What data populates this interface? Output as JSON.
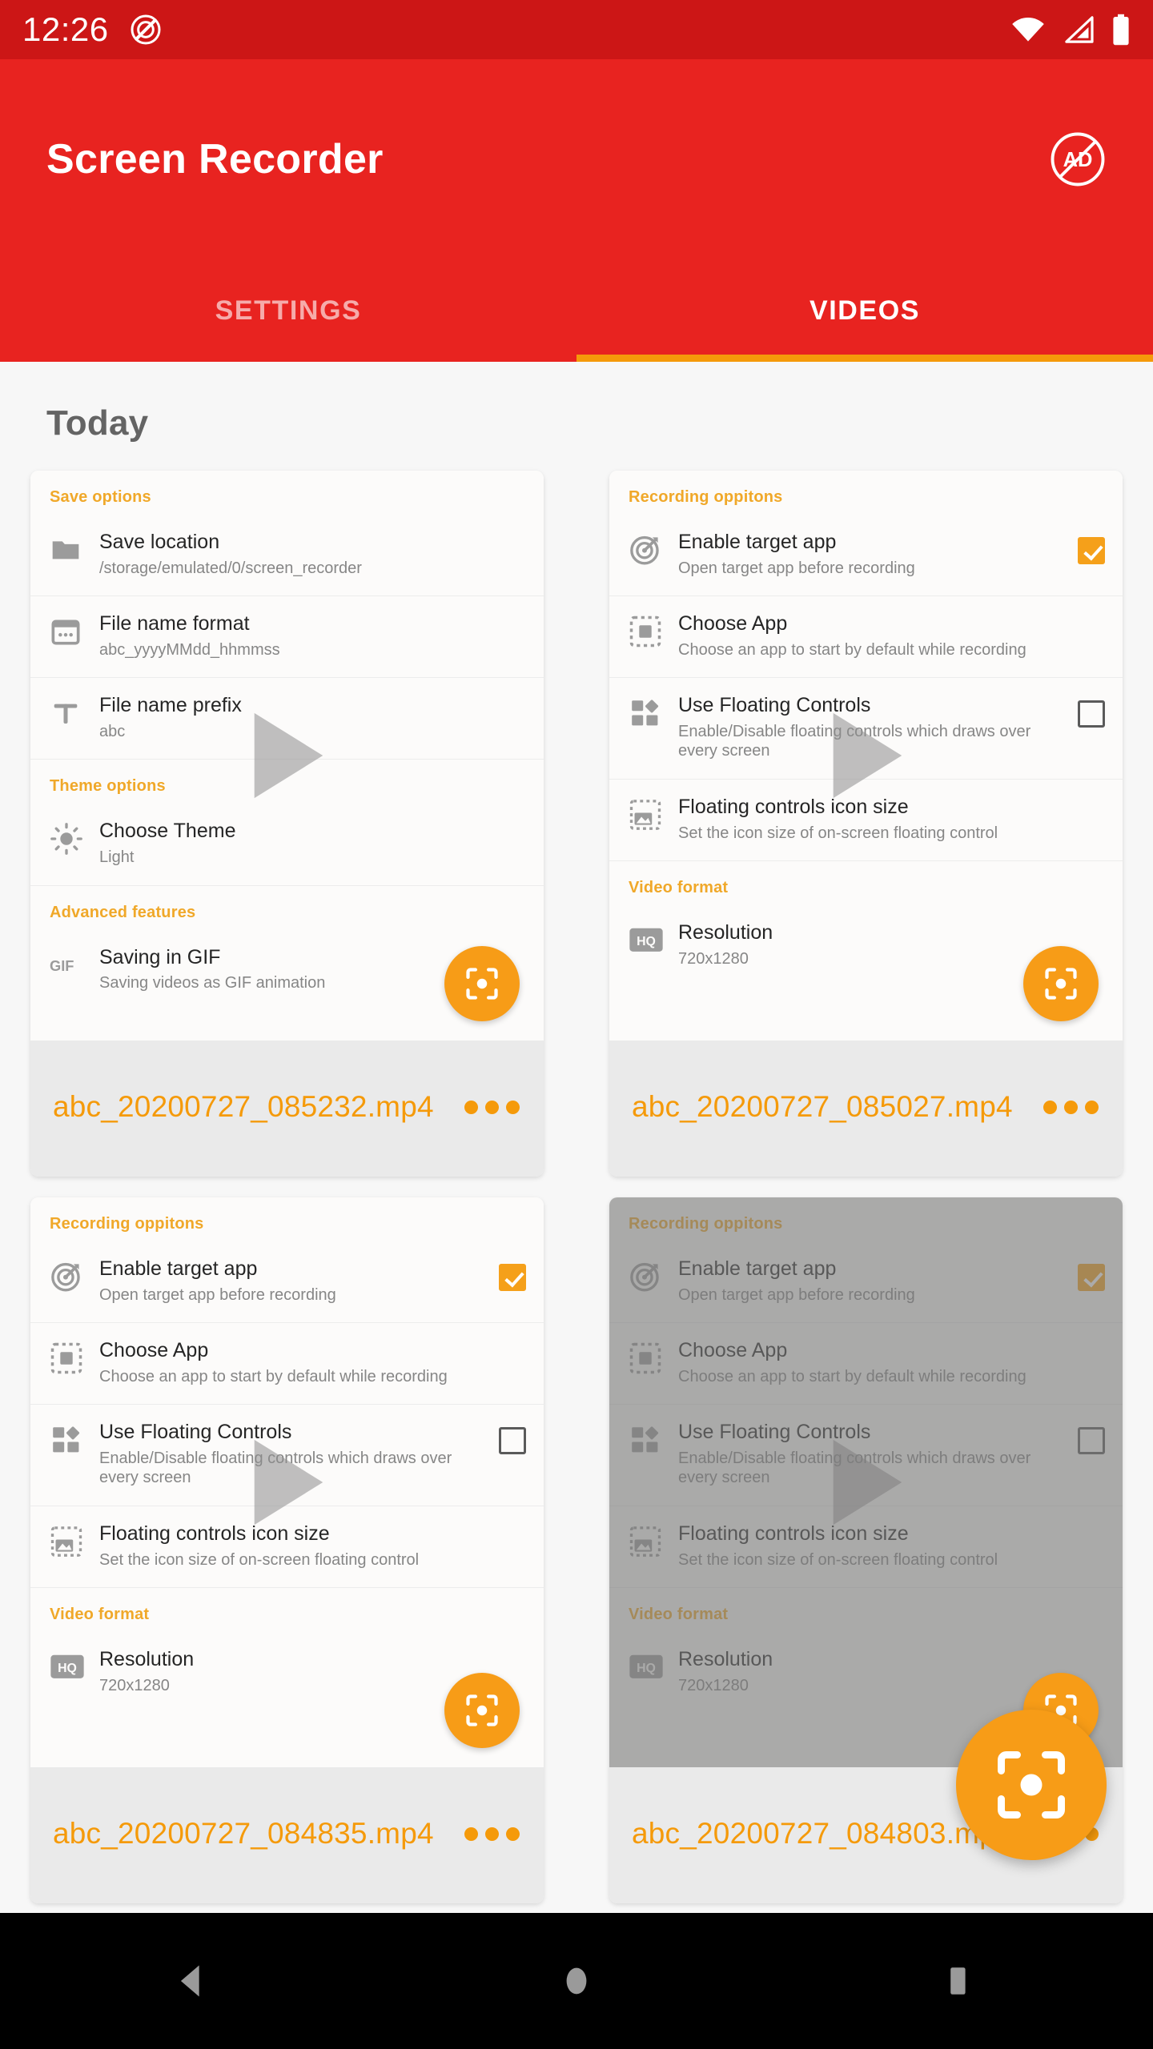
{
  "statusbar": {
    "time": "12:26",
    "icons": [
      "screen-recorder-status-icon",
      "wifi-icon",
      "signal-icon",
      "battery-icon"
    ]
  },
  "appbar": {
    "title": "Screen Recorder",
    "ad_button": "no-ads-icon",
    "accent_red": "#e82320",
    "accent_orange": "#f59a0a",
    "tabs": [
      {
        "label": "SETTINGS",
        "active": false
      },
      {
        "label": "VIDEOS",
        "active": true
      }
    ]
  },
  "main": {
    "section_title": "Today",
    "videos": [
      {
        "file_name": "abc_20200727_085232.mp4",
        "more_label": "more-options",
        "dimmed": false,
        "thumbnail_kind": "save-options",
        "thumbnail": {
          "groups": [
            {
              "header": "Save options",
              "rows": [
                {
                  "icon": "folder-icon",
                  "title": "Save location",
                  "sub": "/storage/emulated/0/screen_recorder",
                  "checkbox": null
                },
                {
                  "icon": "calendar-icon",
                  "title": "File name format",
                  "sub": "abc_yyyyMMdd_hhmmss",
                  "checkbox": null
                },
                {
                  "icon": "text-format-icon",
                  "title": "File name prefix",
                  "sub": "abc",
                  "checkbox": null
                }
              ]
            },
            {
              "header": "Theme options",
              "rows": [
                {
                  "icon": "brightness-icon",
                  "title": "Choose Theme",
                  "sub": "Light",
                  "checkbox": null
                }
              ]
            },
            {
              "header": "Advanced features",
              "rows": [
                {
                  "icon": "gif-icon",
                  "title": "Saving in GIF",
                  "sub": "Saving videos as GIF animation",
                  "checkbox": null
                }
              ]
            }
          ]
        }
      },
      {
        "file_name": "abc_20200727_085027.mp4",
        "more_label": "more-options",
        "dimmed": false,
        "thumbnail_kind": "recording-options",
        "thumbnail": {
          "groups": [
            {
              "header": "Recording oppitons",
              "rows": [
                {
                  "icon": "target-icon",
                  "title": "Enable target app",
                  "sub": "Open target app before recording",
                  "checkbox": "checked"
                },
                {
                  "icon": "select-app-icon",
                  "title": "Choose App",
                  "sub": "Choose an app to start by default while recording",
                  "checkbox": null
                },
                {
                  "icon": "floating-controls-icon",
                  "title": "Use Floating Controls",
                  "sub": "Enable/Disable floating controls which draws over every screen",
                  "checkbox": "unchecked"
                },
                {
                  "icon": "image-size-icon",
                  "title": "Floating controls icon size",
                  "sub": "Set the icon size of on-screen floating control",
                  "checkbox": null
                }
              ]
            },
            {
              "header": "Video format",
              "rows": [
                {
                  "icon": "hq-icon",
                  "title": "Resolution",
                  "sub": "720x1280",
                  "checkbox": null
                }
              ]
            }
          ]
        }
      },
      {
        "file_name": "abc_20200727_084835.mp4",
        "more_label": "more-options",
        "dimmed": false,
        "thumbnail_kind": "recording-options",
        "thumbnail": {
          "groups": [
            {
              "header": "Recording oppitons",
              "rows": [
                {
                  "icon": "target-icon",
                  "title": "Enable target app",
                  "sub": "Open target app before recording",
                  "checkbox": "checked"
                },
                {
                  "icon": "select-app-icon",
                  "title": "Choose App",
                  "sub": "Choose an app to start by default while recording",
                  "checkbox": null
                },
                {
                  "icon": "floating-controls-icon",
                  "title": "Use Floating Controls",
                  "sub": "Enable/Disable floating controls which draws over every screen",
                  "checkbox": "unchecked"
                },
                {
                  "icon": "image-size-icon",
                  "title": "Floating controls icon size",
                  "sub": "Set the icon size of on-screen floating control",
                  "checkbox": null
                }
              ]
            },
            {
              "header": "Video format",
              "rows": [
                {
                  "icon": "hq-icon",
                  "title": "Resolution",
                  "sub": "720x1280",
                  "checkbox": null
                }
              ]
            }
          ]
        }
      },
      {
        "file_name": "abc_20200727_084803.mp4",
        "more_label": "more-options",
        "dimmed": true,
        "thumbnail_kind": "recording-options",
        "thumbnail": {
          "groups": [
            {
              "header": "Recording oppitons",
              "rows": [
                {
                  "icon": "target-icon",
                  "title": "Enable target app",
                  "sub": "Open target app before recording",
                  "checkbox": "checked"
                },
                {
                  "icon": "select-app-icon",
                  "title": "Choose App",
                  "sub": "Choose an app to start by default while recording",
                  "checkbox": null
                },
                {
                  "icon": "floating-controls-icon",
                  "title": "Use Floating Controls",
                  "sub": "Enable/Disable floating controls which draws over every screen",
                  "checkbox": "unchecked"
                },
                {
                  "icon": "image-size-icon",
                  "title": "Floating controls icon size",
                  "sub": "Set the icon size of on-screen floating control",
                  "checkbox": null
                }
              ]
            },
            {
              "header": "Video format",
              "rows": [
                {
                  "icon": "hq-icon",
                  "title": "Resolution",
                  "sub": "720x1280",
                  "checkbox": null
                }
              ]
            }
          ]
        }
      }
    ]
  },
  "fab": {
    "icon": "record-capture-icon"
  },
  "navbar": {
    "back": "back-triangle-icon",
    "home": "home-circle-icon",
    "recents": "recents-square-icon"
  }
}
